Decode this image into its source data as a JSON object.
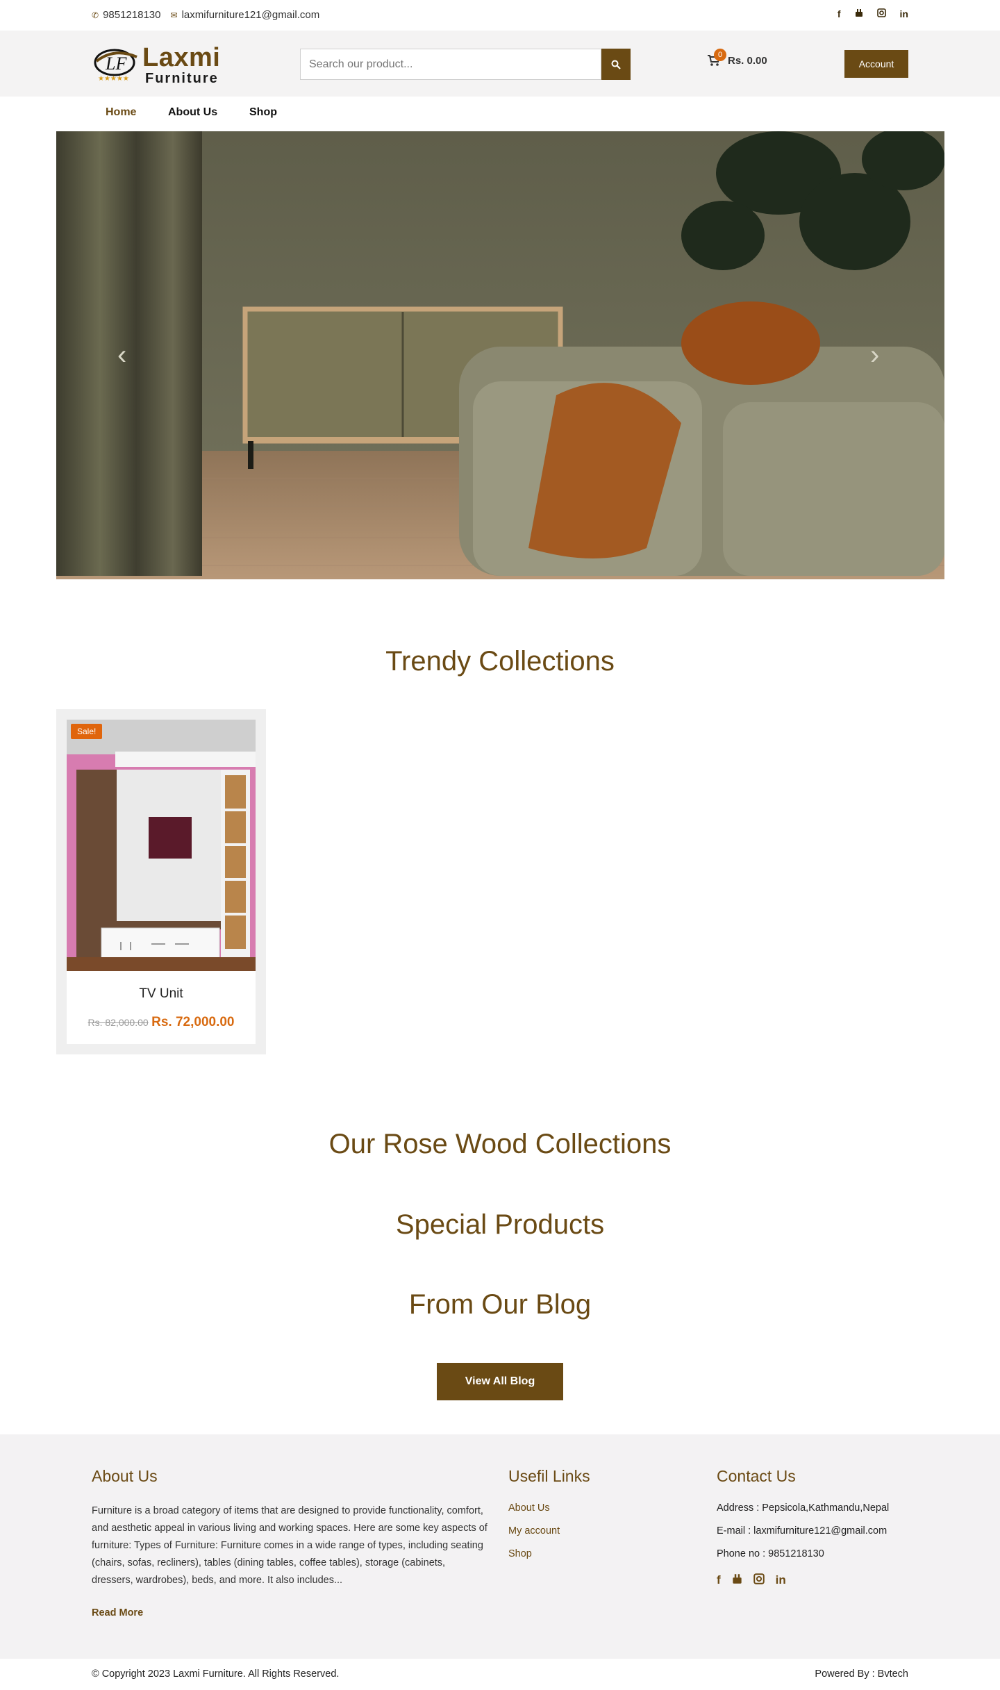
{
  "topbar": {
    "phone": "9851218130",
    "email": "laxmifurniture121@gmail.com",
    "social": [
      "f",
      "yt",
      "ig",
      "in"
    ]
  },
  "header": {
    "logo_line1": "Laxmi",
    "logo_line2": "Furniture",
    "logo_initials": "LF",
    "search_placeholder": "Search our product...",
    "cart_count": "0",
    "cart_total": "Rs. 0.00",
    "account_label": "Account"
  },
  "nav": {
    "items": [
      "Home",
      "About Us",
      "Shop"
    ]
  },
  "sections": {
    "trendy": "Trendy Collections",
    "rosewood": "Our Rose Wood Collections",
    "special": "Special Products",
    "blog": "From Our Blog",
    "view_blog": "View All Blog"
  },
  "product": {
    "sale_badge": "Sale!",
    "name": "TV Unit",
    "old_price": "Rs. 82,000.00",
    "new_price": "Rs. 72,000.00"
  },
  "footer": {
    "about_title": "About Us",
    "about_text": "Furniture is a broad category of items that are designed to provide functionality, comfort, and aesthetic appeal in various living and working spaces. Here are some key aspects of furniture: Types of Furniture: Furniture comes in a wide range of types, including seating (chairs, sofas, recliners), tables (dining tables, coffee tables), storage (cabinets, dressers, wardrobes), beds, and more. It also includes...",
    "read_more": "Read More",
    "links_title": "Usefil Links",
    "links": [
      "About Us",
      "My account",
      "Shop"
    ],
    "contact_title": "Contact Us",
    "address": "Address : Pepsicola,Kathmandu,Nepal",
    "email": "E-mail : laxmifurniture121@gmail.com",
    "phone": "Phone no : 9851218130",
    "copyright": "© Copyright 2023 Laxmi Furniture. All Rights Reserved.",
    "powered": "Powered By : Bvtech"
  },
  "colors": {
    "brand": "#6a4a14",
    "accent": "#d86a10",
    "header_bg": "#f4f3f3"
  }
}
